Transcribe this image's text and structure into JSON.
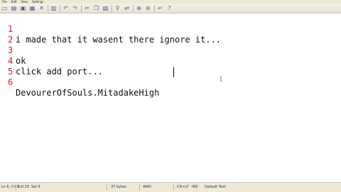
{
  "menu": [
    "File",
    "Edit",
    "View",
    "Settings"
  ],
  "toolbar": {
    "icons": [
      "new-file-icon",
      "open-folder-icon",
      "save-icon",
      "save-all-icon",
      "close-icon",
      "print-icon",
      "undo-icon",
      "redo-icon",
      "cut-icon",
      "copy-icon",
      "paste-icon",
      "find-icon",
      "replace-icon",
      "zoom-in-icon",
      "zoom-out-icon",
      "word-wrap-icon",
      "help-icon"
    ]
  },
  "editor": {
    "lines": [
      {
        "num": "1",
        "text": "i made that it wasent there ignore it..."
      },
      {
        "num": "2",
        "text": ""
      },
      {
        "num": "3",
        "text": "ok"
      },
      {
        "num": "4",
        "text": "click add port..."
      },
      {
        "num": "5",
        "text": ""
      },
      {
        "num": "6",
        "text": "DevourerOfSouls.MitadakeHigh"
      }
    ]
  },
  "status": {
    "position": "Ln 6, Ch 6",
    "column": "Col 29",
    "sel": "Sel 0",
    "size": "37 bytes",
    "encoding": "ANSI",
    "eol": "CR+LF",
    "mode": "INS",
    "scheme": "Default Text"
  }
}
